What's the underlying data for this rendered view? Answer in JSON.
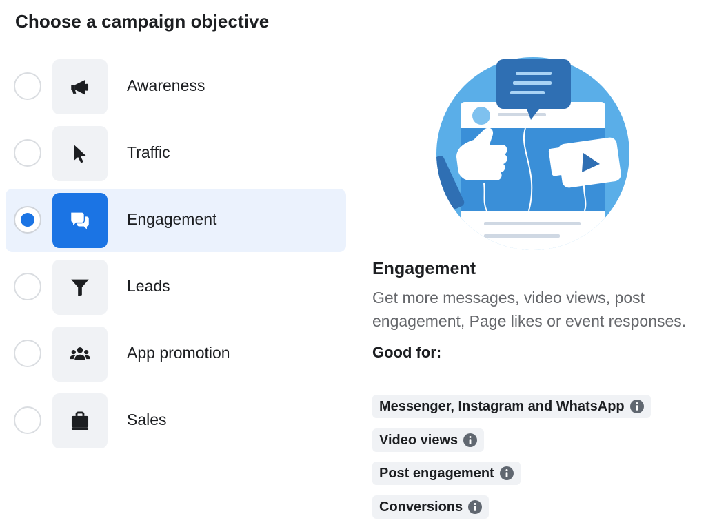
{
  "page_title": "Choose a campaign objective",
  "objectives": [
    {
      "label": "Awareness",
      "icon": "megaphone-icon",
      "selected": false
    },
    {
      "label": "Traffic",
      "icon": "cursor-icon",
      "selected": false
    },
    {
      "label": "Engagement",
      "icon": "chat-bubbles-icon",
      "selected": true
    },
    {
      "label": "Leads",
      "icon": "funnel-icon",
      "selected": false
    },
    {
      "label": "App promotion",
      "icon": "people-icon",
      "selected": false
    },
    {
      "label": "Sales",
      "icon": "shopping-bag-icon",
      "selected": false
    }
  ],
  "detail": {
    "title": "Engagement",
    "description": "Get more messages, video views, post engagement, Page likes or event responses.",
    "good_for_label": "Good for:",
    "good_for_items": [
      {
        "label": "Messenger, Instagram and WhatsApp",
        "icon": "info-icon"
      },
      {
        "label": "Video views",
        "icon": "info-icon"
      },
      {
        "label": "Post engagement",
        "icon": "info-icon"
      },
      {
        "label": "Conversions",
        "icon": "info-icon"
      }
    ]
  },
  "colors": {
    "accent": "#1b74e4",
    "selected_row_bg": "#ebf2fd",
    "tile_bg": "#f0f2f5",
    "icon_dark": "#1c1e21",
    "muted_text": "#65676b",
    "illustration_circle": "#5aaee8",
    "illustration_dark": "#2f6fb3"
  }
}
